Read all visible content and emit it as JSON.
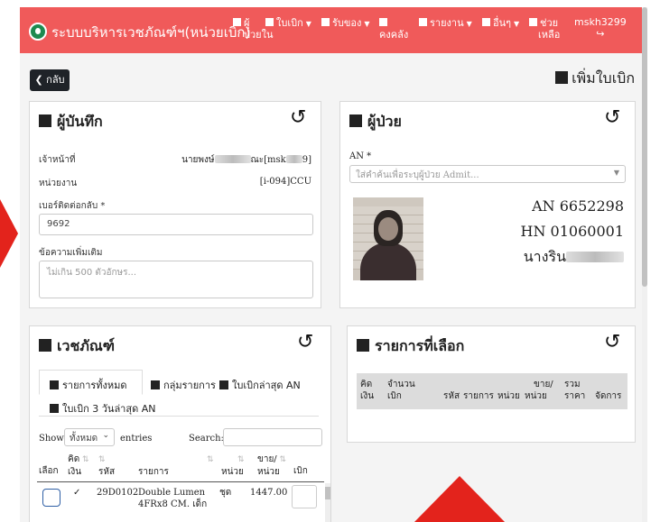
{
  "nav": {
    "brand": "ระบบบริหารเวชภัณฑ์ฯ(หน่วยเบิก)",
    "items": [
      {
        "label": "ผู้",
        "label2": "ป่วยใน",
        "caret": false
      },
      {
        "label": "ใบเบิก",
        "label2": "",
        "caret": true
      },
      {
        "label": "รับของ",
        "label2": "",
        "caret": true
      },
      {
        "label": "",
        "label2": "คงคลัง",
        "caret": false
      },
      {
        "label": "รายงาน",
        "label2": "",
        "caret": true
      },
      {
        "label": "อื่นๆ",
        "label2": "",
        "caret": true
      },
      {
        "label": "ช่วย",
        "label2": "เหลือ",
        "caret": false
      }
    ],
    "user": "mskh3299",
    "logout_icon": "sign-out-icon"
  },
  "page": {
    "back_label": "กลับ",
    "title": "เพิ่มใบเบิก"
  },
  "recorder": {
    "title": "ผู้บันทึก",
    "officer_label": "เจ้าหน้าที่",
    "officer_prefix": "นายพงษ์",
    "officer_mid": "ณะ[msk",
    "officer_suffix": "9]",
    "unit_label": "หน่วยงาน",
    "unit_value": "[i-094]CCU",
    "phone_label": "เบอร์ติดต่อกลับ *",
    "phone_value": "9692",
    "message_label": "ข้อความเพิ่มเติม",
    "message_placeholder": "ไม่เกิน 500 ตัวอักษร..."
  },
  "patient": {
    "title": "ผู้ป่วย",
    "an_label": "AN *",
    "an_placeholder": "ใส่คำค้นเพื่อระบุผู้ป่วย Admit...",
    "an_value": "AN 6652298",
    "hn_value": "HN 01060001",
    "name_value": "นางริน"
  },
  "supplies": {
    "title": "เวชภัณฑ์",
    "tabs": [
      "รายการทั้งหมด",
      "กลุ่มรายการ",
      "ใบเบิกล่าสุด AN",
      "ใบเบิก 3 วันล่าสุด AN"
    ],
    "show_label": "Show",
    "show_value": "ทั้งหมด",
    "entries_label": "entries",
    "search_label": "Search:",
    "columns": [
      {
        "line1": "",
        "line2": "เลือก"
      },
      {
        "line1": "คิด",
        "line2": "เงิน"
      },
      {
        "line1": "",
        "line2": "รหัส"
      },
      {
        "line1": "",
        "line2": "รายการ"
      },
      {
        "line1": "",
        "line2": "หน่วย"
      },
      {
        "line1": "ขาย/",
        "line2": "หน่วย"
      },
      {
        "line1": "",
        "line2": "เบิก"
      }
    ],
    "rows": [
      {
        "code": "29D0102",
        "name": "Double Lumen",
        "name2": "4FRx8 CM. เด็ก",
        "unit": "ชุด",
        "price": "1447.00",
        "charged": "✓"
      }
    ]
  },
  "selected": {
    "title": "รายการที่เลือก",
    "columns": [
      {
        "line1": "คิด",
        "line2": "เงิน"
      },
      {
        "line1": "จำนวน",
        "line2": "เบิก"
      },
      {
        "line1": "",
        "line2": "รหัส"
      },
      {
        "line1": "",
        "line2": "รายการ"
      },
      {
        "line1": "",
        "line2": "หน่วย"
      },
      {
        "line1": "ขาย/",
        "line2": "หน่วย"
      },
      {
        "line1": "รวม",
        "line2": "ราคา"
      },
      {
        "line1": "",
        "line2": "จัดการ"
      }
    ]
  },
  "colors": {
    "navbar": "#f05a5a",
    "annotation_arrow": "#e3231c",
    "back_button": "#1f2328"
  }
}
